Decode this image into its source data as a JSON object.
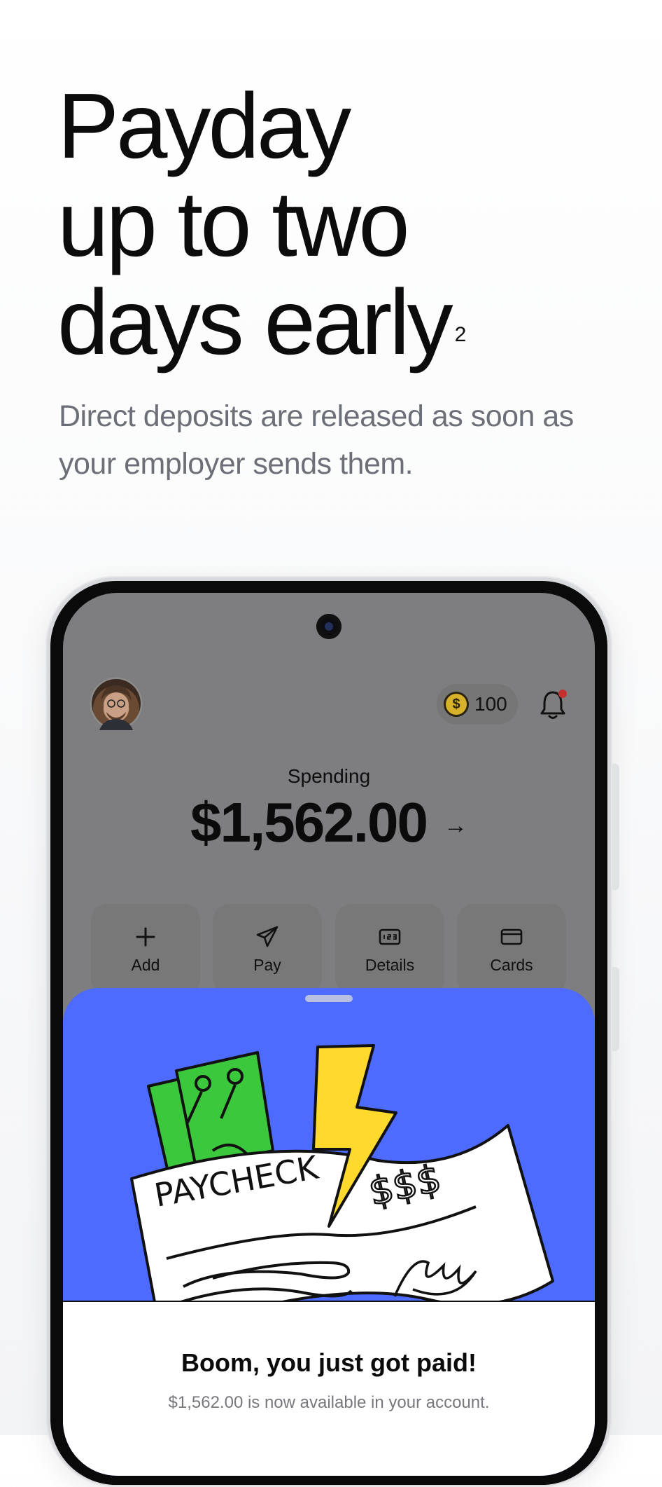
{
  "hero": {
    "headline_lines": [
      "Payday",
      "up to two",
      "days early"
    ],
    "footnote": "2",
    "subhead": "Direct deposits are released as soon as your employer sends them."
  },
  "phone": {
    "header": {
      "avatar_icon": "profile-photo",
      "coin_icon": "dollar-coin-icon",
      "coin_symbol": "$",
      "points": "100",
      "notification_icon": "bell-icon",
      "notification_dot_color": "#c43030"
    },
    "balance": {
      "label": "Spending",
      "amount": "$1,562.00",
      "arrow": "→"
    },
    "actions": [
      {
        "label": "Add",
        "icon": "plus-icon"
      },
      {
        "label": "Pay",
        "icon": "paper-plane-icon"
      },
      {
        "label": "Details",
        "icon": "account-numbers-icon"
      },
      {
        "label": "Cards",
        "icon": "card-icon"
      }
    ],
    "sheet": {
      "background_color": "#4e6bff",
      "illustration": {
        "check_text": "PAYCHECK",
        "amount_text": "$$$"
      },
      "title": "Boom, you just got paid!",
      "subtitle": "$1,562.00 is now available in your account."
    }
  }
}
